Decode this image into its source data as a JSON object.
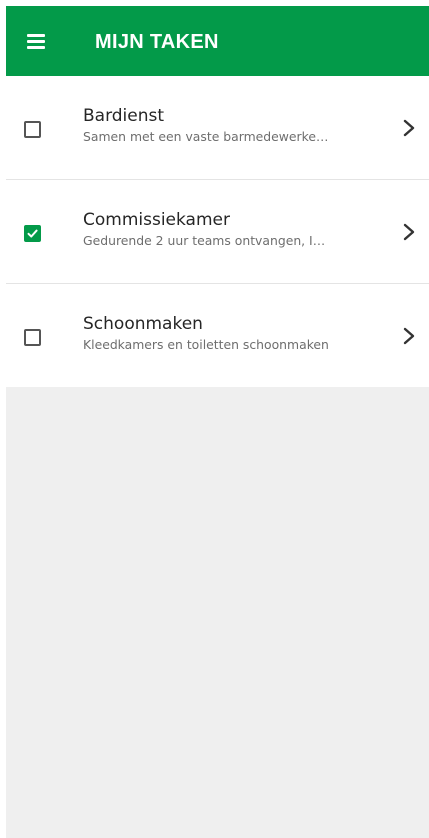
{
  "app_bar": {
    "title": "MIJN TAKEN",
    "menu_icon": "hamburger-menu-icon",
    "background_color": "#039a49"
  },
  "tasks": [
    {
      "title": "Bardienst",
      "subtitle": "Samen met een vaste barmedewerke…",
      "checked": false,
      "chevron_icon": "chevron-right-icon"
    },
    {
      "title": "Commissiekamer",
      "subtitle": "Gedurende 2 uur teams ontvangen, I…",
      "checked": true,
      "chevron_icon": "chevron-right-icon"
    },
    {
      "title": "Schoonmaken",
      "subtitle": "Kleedkamers en toiletten schoonmaken",
      "checked": false,
      "chevron_icon": "chevron-right-icon"
    }
  ],
  "colors": {
    "accent": "#039a49",
    "empty_area": "#efefef"
  }
}
